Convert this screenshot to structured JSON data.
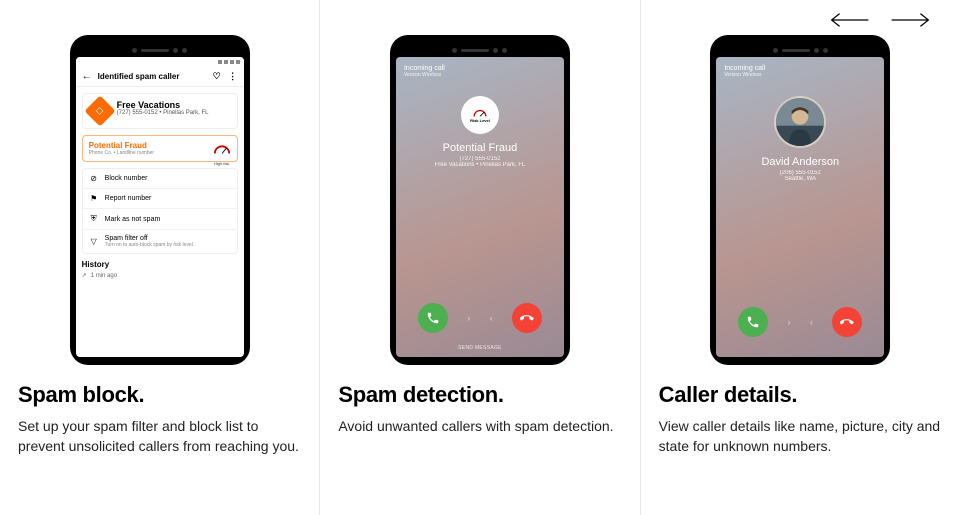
{
  "carousel": {
    "prev_icon": "arrow-left",
    "next_icon": "arrow-right"
  },
  "panels": [
    {
      "title": "Spam block.",
      "desc": "Set up your spam filter and block list to prevent unsolicited callers from reaching you.",
      "phone": {
        "header": {
          "title": "Identified spam caller"
        },
        "caller": {
          "name": "Free Vacations",
          "sub": "(727) 555-0152 • Pinellas Park, FL"
        },
        "fraud": {
          "label": "Potential Fraud",
          "sub": "Phone Co. • Landline number",
          "gauge_label": "High risk"
        },
        "actions": [
          {
            "icon": "⊘",
            "label": "Block number"
          },
          {
            "icon": "⚑",
            "label": "Report number"
          },
          {
            "icon": "⛨",
            "label": "Mark as not spam"
          },
          {
            "icon": "▽",
            "label": "Spam filter off",
            "sub": "Turn on to auto-block spam by risk level."
          }
        ],
        "history": {
          "title": "History",
          "item": "1 min ago"
        }
      }
    },
    {
      "title": "Spam detection.",
      "desc": "Avoid unwanted callers with spam detection.",
      "phone": {
        "incoming_label": "Incoming call",
        "carrier": "Verizon Wireless",
        "risk_label": "Risk Level",
        "name": "Potential Fraud",
        "phone": "(727) 555-0152",
        "loc": "Free Vacations • Pinellas Park, FL",
        "send_message": "SEND MESSAGE"
      }
    },
    {
      "title": "Caller details.",
      "desc": "View caller details like name, picture, city and state for unknown numbers.",
      "phone": {
        "incoming_label": "Incoming call",
        "carrier": "Verizon Wireless",
        "name": "David Anderson",
        "phone": "(206) 555-0152",
        "loc": "Seattle, WA"
      }
    }
  ]
}
